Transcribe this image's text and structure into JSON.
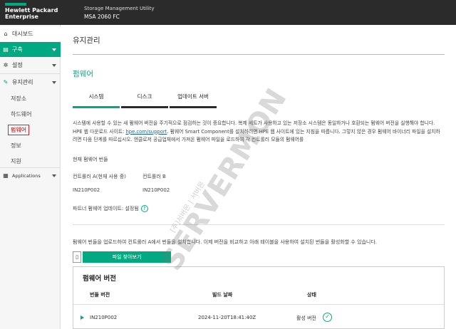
{
  "header": {
    "brand_line1": "Hewlett Packard",
    "brand_line2": "Enterprise",
    "app_title": "Storage Management Utility",
    "model": "MSA 2060 FC",
    "brand_color": "#01a982"
  },
  "sidebar": {
    "dashboard": "대시보드",
    "provisioning": "구축",
    "settings": "설정",
    "maintenance": "유지관리",
    "sub_items": [
      "저장소",
      "하드웨어",
      "펌웨어",
      "정보",
      "지원"
    ],
    "active_sub": "펌웨어",
    "applications": "Applications"
  },
  "main": {
    "page_title": "유지관리",
    "section_title": "펌웨어",
    "tabs": [
      "시스템",
      "디스크",
      "업데이트 서버"
    ],
    "active_tab": "시스템",
    "description": {
      "before_link": "시스템에 사용할 수 있는 새 펌웨어 버전을 주기적으로 점검하는 것이 중요합니다. 복제 세트가 사용하고 있는 저장소 시스템은 동일하거나 호환되는 펌웨어 버전을 실행해야 합니다. HPE 웹 다운로드 사이트: ",
      "link": "hpe.com/support",
      "after_link": ". 펌웨어 Smart Component를 설치하려면 HPE 웹 사이트에 있는 지침을 따릅니다. 그렇지 않은 경우 펌웨어 바이너리 파일을 설치하려면 다음 단계를 따르십시오. 엔클로저 공급업체에서 가져온 펌웨어 파일을 로드하여 각 컨트롤러 모듈의 펌웨어를"
    },
    "current_bundle_label": "현재 펌웨어 번들",
    "controller_a_label": "컨트롤러 A(현재 사용 중)",
    "controller_b_label": "컨트롤러 B",
    "controller_a_value": "IN210P002",
    "controller_b_value": "IN210P002",
    "partner_update_label": "파트너 펌웨어 업데이트: 설정됨",
    "upload_desc": "펌웨어 번들을 업로드하여 컨트롤러 A에서 번들을 설치합니다. 이제 버전을 비교하고 아래 테이블을 사용하여 설치된 번들을 활성화할 수 있습니다.",
    "file_button": "파일 찾아보기",
    "panel_title": "펌웨어 버전",
    "table": {
      "headers": [
        "번들 버전",
        "빌드 날짜",
        "상태"
      ],
      "rows": [
        {
          "bundle": "IN210P002",
          "build_date": "2024-11-20T18:41:40Z",
          "status": "활성 버전"
        }
      ]
    }
  },
  "watermark": {
    "text": "SERVERMON",
    "sub": "[주]서버몬 | 서버몬"
  }
}
